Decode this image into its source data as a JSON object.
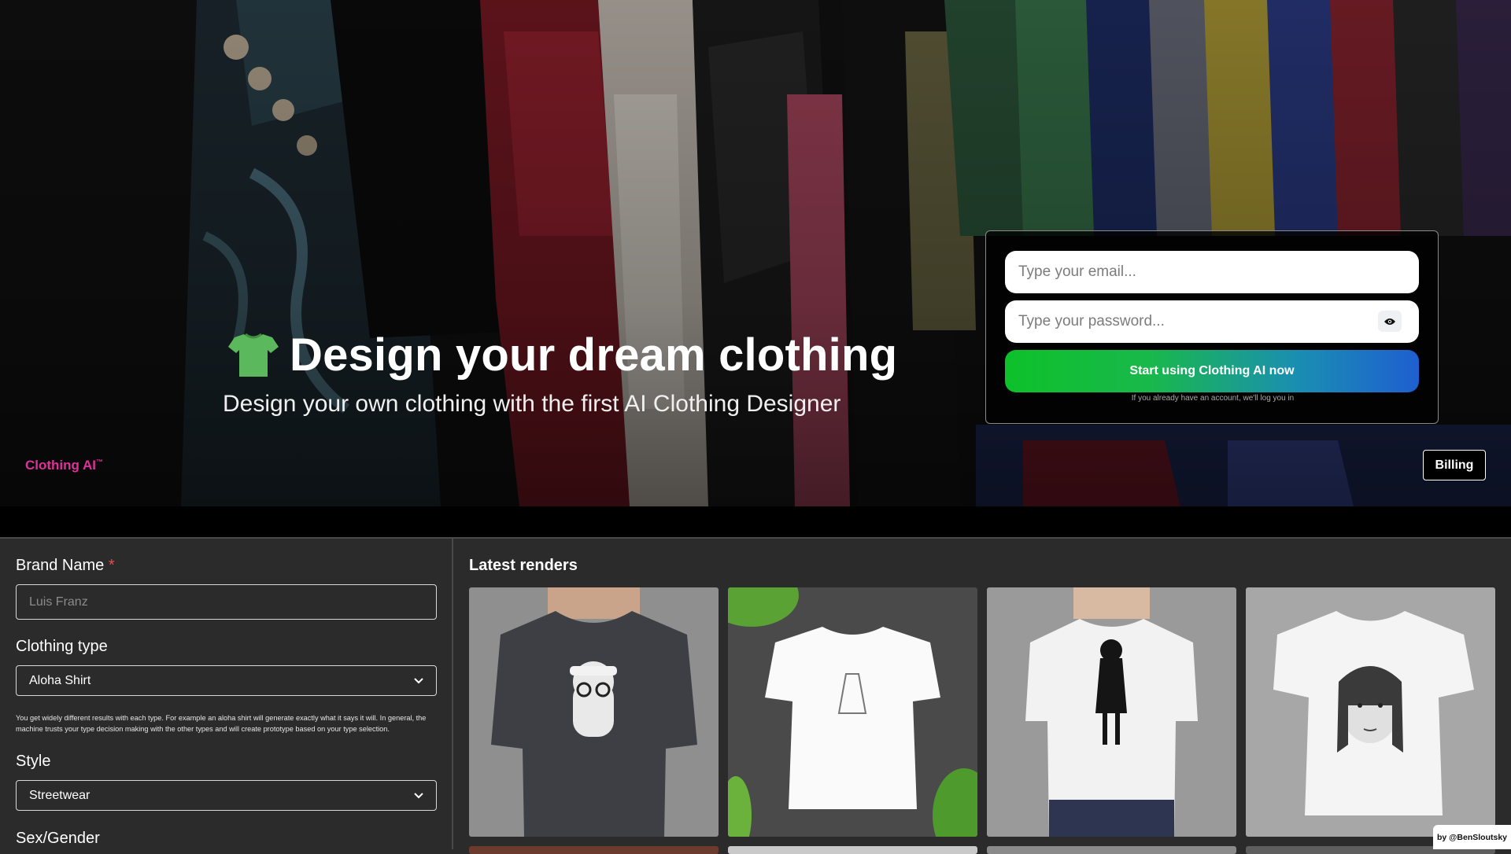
{
  "hero": {
    "headline": "Design your dream clothing",
    "subheadline": "Design your own clothing with the first AI Clothing Designer",
    "brand": "Clothing AI",
    "brand_mark": "™",
    "billing_label": "Billing",
    "icons": {
      "headline": "t-shirt-icon"
    }
  },
  "login": {
    "email_placeholder": "Type your email...",
    "password_placeholder": "Type your password...",
    "show_password_icon": "eye-icon",
    "start_label": "Start using Clothing AI now",
    "note": "If you already have an account, we'll log you in"
  },
  "form": {
    "brand_name_label": "Brand Name",
    "required_mark": "*",
    "brand_name_placeholder": "Luis Franz",
    "clothing_type_label": "Clothing type",
    "clothing_type_value": "Aloha Shirt",
    "clothing_type_hint": "You get widely different results with each type. For example an aloha shirt will generate exactly what it says it will. In general, the machine trusts your type decision making with the other types and will create prototype based on your type selection.",
    "style_label": "Style",
    "style_value": "Streetwear",
    "gender_label": "Sex/Gender"
  },
  "renders": {
    "title": "Latest renders"
  },
  "footer": {
    "credit": "by @BenSloutsky"
  },
  "colors": {
    "brand": "#e0309a",
    "accent_start": "#0dc12a",
    "accent_end": "#1e5fd0",
    "panel_bg": "#2b2b2b"
  }
}
